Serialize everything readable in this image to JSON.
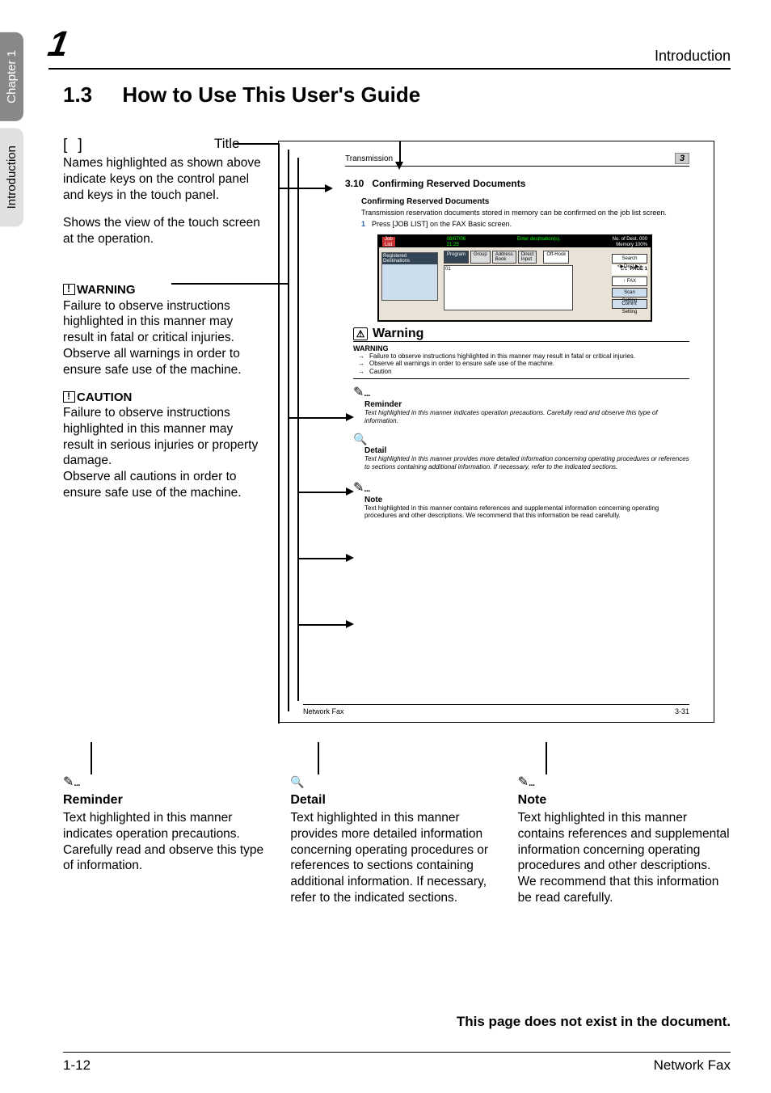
{
  "sideTabs": {
    "chapter": "Chapter 1",
    "section": "Introduction"
  },
  "header": {
    "big": "1",
    "intro": "Introduction"
  },
  "sectionTitle": {
    "num": "1.3",
    "text": "How to Use This User's Guide"
  },
  "labels": {
    "brackets": "[        ]",
    "title": "Title"
  },
  "left": {
    "names": "Names highlighted as shown above indicate keys on the control panel and keys in the touch panel.",
    "shows": "Shows the view of the touch screen at the operation.",
    "warnHead": "WARNING",
    "warnBody": "Failure to observe instructions highlighted in this manner may result in fatal or critical injuries. Observe all warnings in order to ensure safe use of the machine.",
    "cautHead": "CAUTION",
    "cautBody": "Failure to observe instructions highlighted in this manner may result in serious injuries or property damage.\nObserve all cautions in order to ensure safe use of the machine."
  },
  "pagebox": {
    "trans": "Transmission",
    "tileNum": "3",
    "h4num": "3.10",
    "h4": "Confirming Reserved Documents",
    "h5": "Confirming Reserved Documents",
    "p1": "Transmission reservation documents stored in memory can be confirmed on the job list screen.",
    "step1": "Press [JOB LIST] on the FAX Basic screen.",
    "warningTitle": "Warning",
    "wsub": "WARNING",
    "w1": "Failure to observe instructions highlighted in this manner may result in fatal or critical injuries.",
    "w2": "Observe all warnings in order to ensure safe use of the machine.",
    "w3": "Caution",
    "reminderHead": "Reminder",
    "reminderText": "Text highlighted in this manner indicates operation precautions. Carefully read and observe this type of information.",
    "detailHead": "Detail",
    "detailText": "Text highlighted in this manner provides more detailed information concerning operating procedures or references to sections containing additional information. If necessary, refer to the indicated sections.",
    "noteHead": "Note",
    "noteText": "Text highlighted in this manner contains references and supplemental information concerning operating procedures and other descriptions. We recommend that this information be read carefully.",
    "footLeft": "Network Fax",
    "footRight": "3-31",
    "screen": {
      "jobList": "Job\nList",
      "datetime": "08/07/06\n21:25",
      "prompt": "Enter destination(s).",
      "noof": "No. of\nDest.",
      "noofVal": "000",
      "memory": "Memory",
      "memoryVal": "100%",
      "regReuse": "Registered\nDestinations",
      "tabs": [
        "Program",
        "Group",
        "Address\nBook",
        "Direct\nInput"
      ],
      "offHook": "Off-Hook",
      "search": "Search\n<▶Dest.▶>",
      "page": "PAGE 1",
      "fax": "FAX",
      "scanSetting": "Scan\nSetting",
      "commSetting": "Comm.\nSetting",
      "entry": "01"
    }
  },
  "bottom": {
    "reminder": {
      "head": "Reminder",
      "text": "Text highlighted in this manner indicates operation precautions. Carefully read and observe this type of information."
    },
    "detail": {
      "head": "Detail",
      "text": "Text highlighted in this manner provides more detailed information concerning operating procedures or references to sections containing additional information. If necessary, refer to the indicated sections."
    },
    "note": {
      "head": "Note",
      "text": "Text highlighted in this manner contains references and supplemental information concerning operating procedures and other descriptions. We recommend that this information be read carefully."
    }
  },
  "closing": "This page does not exist in the document.",
  "footer": {
    "left": "1-12",
    "right": "Network Fax"
  }
}
